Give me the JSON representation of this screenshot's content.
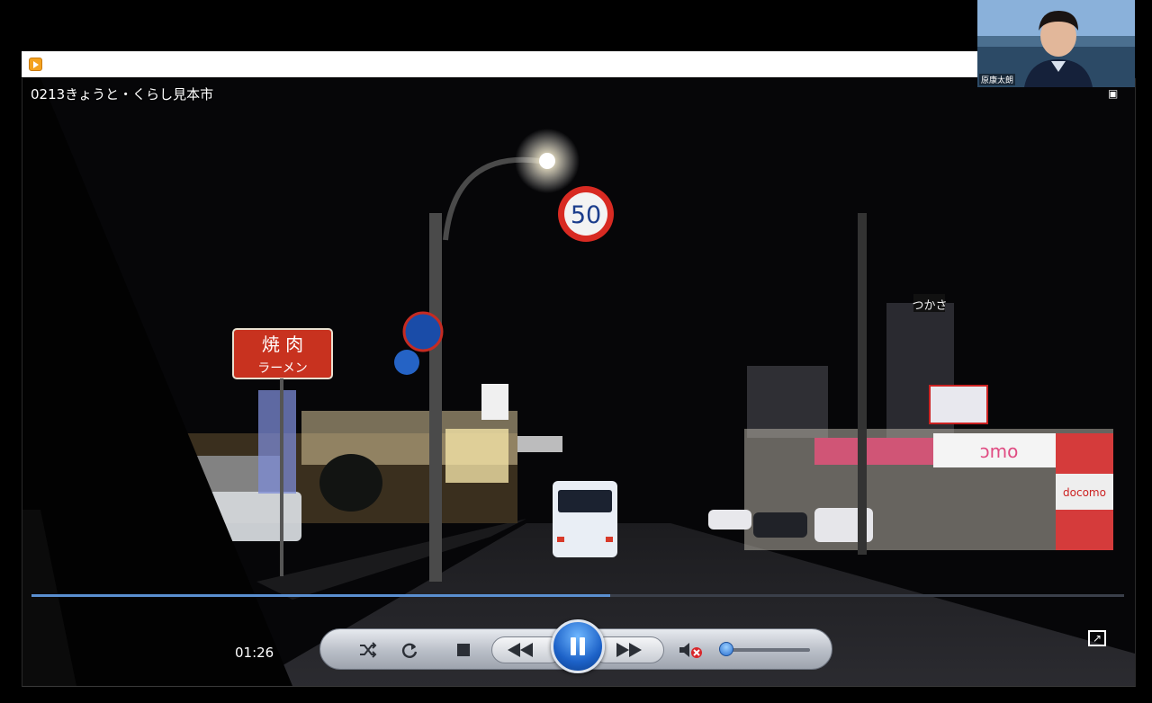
{
  "window": {
    "icon": "media-player-icon"
  },
  "video": {
    "title": "0213きょうと・くらし見本市",
    "current_time": "01:26",
    "progress": 0.53,
    "volume": 0.0,
    "muted": true
  },
  "scene": {
    "speed_sign": "50",
    "shop_sign": "焼 肉",
    "shop_sign_sub": "ラーメン",
    "rooftop_sign": "つかさ",
    "store_sign": "ɔmo",
    "store_sign_right": "docomo"
  },
  "participant": {
    "name": "原康太朗"
  },
  "controls": {
    "shuffle_icon": "shuffle-icon",
    "repeat_icon": "repeat-icon",
    "stop_icon": "stop-icon",
    "prev_icon": "previous-icon",
    "play_pause_icon": "pause-icon",
    "next_icon": "next-icon",
    "mute_icon": "mute-icon",
    "fullscreen_icon": "fullscreen-icon"
  },
  "colors": {
    "seek": "#5a8fd0",
    "play_button": "#1d62c8",
    "controls_bg": "#c4c9d1"
  }
}
